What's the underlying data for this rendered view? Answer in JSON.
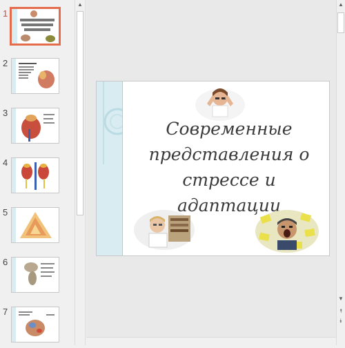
{
  "slides": [
    {
      "number": "1",
      "title": "Современные представления о стрессе и адаптации",
      "active": true
    },
    {
      "number": "2",
      "heading": "ПАДЕНИЕ НАРАСТАНИЯ"
    },
    {
      "number": "3"
    },
    {
      "number": "4"
    },
    {
      "number": "5"
    },
    {
      "number": "6"
    },
    {
      "number": "7"
    }
  ],
  "main_slide": {
    "title": "Современные представления о стрессе и адаптации"
  },
  "icons": {
    "scroll_up": "▲",
    "scroll_down": "▼",
    "prev_slide": "⯭",
    "next_slide": "⯯"
  },
  "colors": {
    "accent": "#e46c4a",
    "slide_band": "#d9ecf1"
  }
}
